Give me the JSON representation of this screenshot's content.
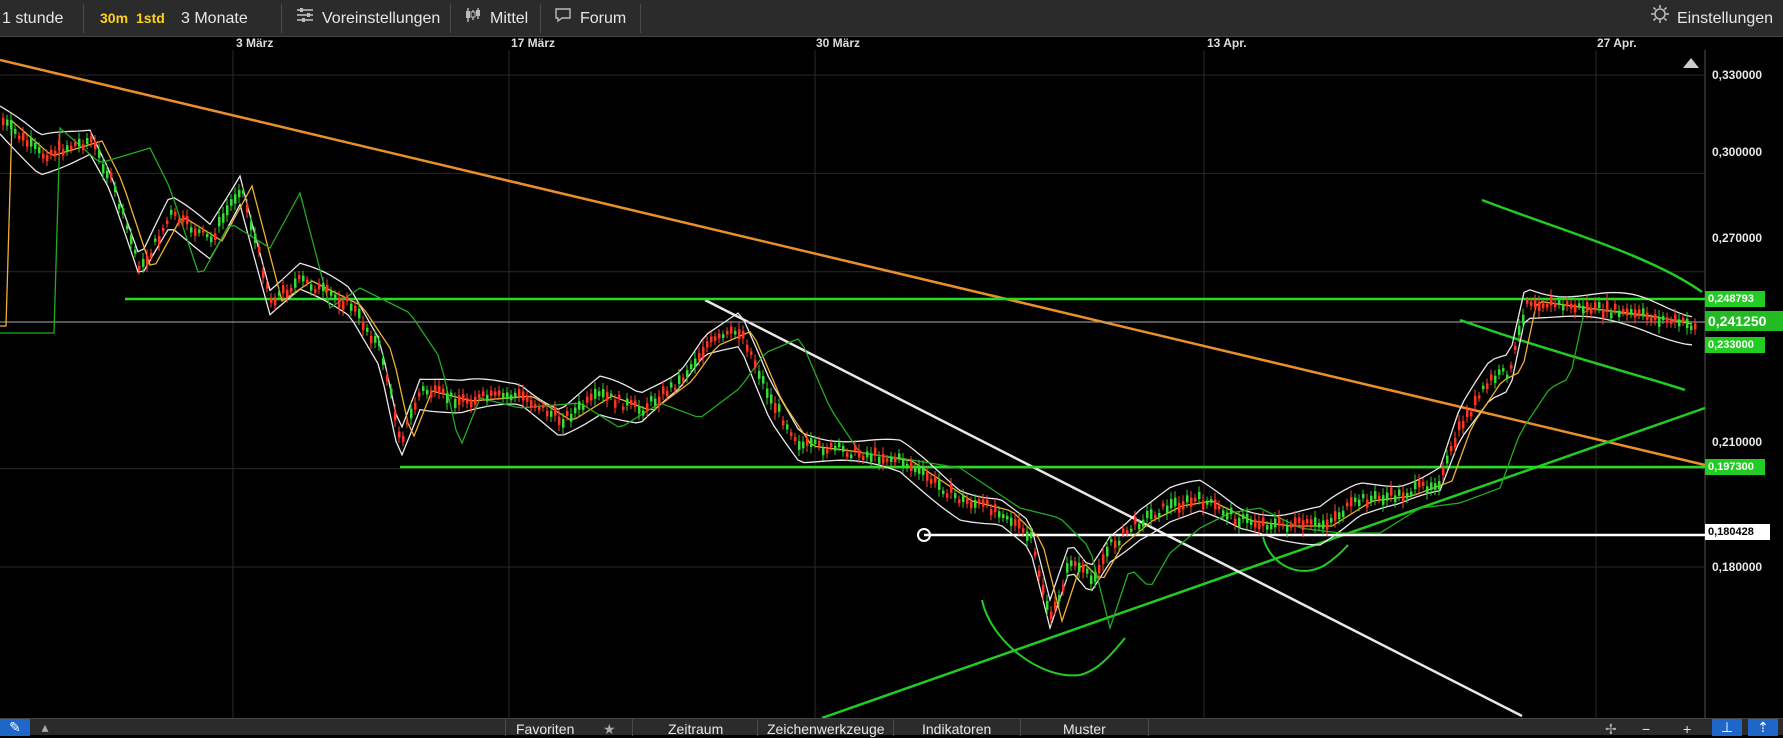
{
  "toolbar": {
    "timeframe_label": "1 stunde",
    "interval_30m": "30m",
    "interval_1std": "1std",
    "range_label": "3 Monate",
    "presets_label": "Voreinstellungen",
    "chart_style_label": "Mittel",
    "forum_label": "Forum",
    "settings_label": "Einstellungen"
  },
  "date_axis": {
    "labels": [
      "3 März",
      "17 März",
      "30 März",
      "13 Apr.",
      "27 Apr."
    ]
  },
  "price_axis": {
    "labels": [
      "0,330000",
      "0,300000",
      "0,270000",
      "0,210000",
      "0,180000"
    ]
  },
  "price_tags": {
    "upper_line": "0,248793",
    "current": "0,241250",
    "lower_band": "0,233000",
    "support": "0,197300",
    "marker": "0,180428"
  },
  "bottombar": {
    "favorites": "Favoriten",
    "period": "Zeitraum",
    "drawing_tools": "Zeichenwerkzeuge",
    "indicators": "Indikatoren",
    "patterns": "Muster"
  },
  "colors": {
    "background": "#000000",
    "toolbar": "#2b2b2b",
    "accent_green": "#22dd22",
    "trend_orange": "#e8902a",
    "yellow": "#ffd21a"
  },
  "chart_data": {
    "type": "line",
    "x": [
      "3 März",
      "17 März",
      "30 März",
      "13 Apr.",
      "27 Apr."
    ],
    "y_ticks": [
      0.33,
      0.3,
      0.27,
      0.21,
      0.18
    ],
    "ylim": [
      0.15,
      0.34
    ],
    "grid": true,
    "last_price": 0.24125,
    "horizontal_levels": [
      0.248793,
      0.233,
      0.1973,
      0.180428
    ]
  }
}
